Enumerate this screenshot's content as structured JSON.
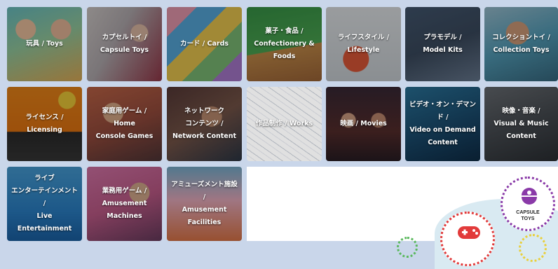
{
  "tiles": [
    {
      "key": "toys",
      "lines": [
        "玩具 / Toys"
      ]
    },
    {
      "key": "capsule",
      "lines": [
        "カプセルトイ /",
        "Capsule Toys"
      ]
    },
    {
      "key": "cards",
      "lines": [
        "カード / Cards"
      ]
    },
    {
      "key": "confection",
      "lines": [
        "菓子・食品 /",
        "Confectionery &",
        "Foods"
      ]
    },
    {
      "key": "lifestyle",
      "lines": [
        "ライフスタイル /",
        "Lifestyle"
      ]
    },
    {
      "key": "plamodel",
      "lines": [
        "プラモデル /",
        "Model Kits"
      ]
    },
    {
      "key": "collection",
      "lines": [
        "コレクショントイ /",
        "Collection Toys"
      ]
    },
    {
      "key": "licensing",
      "lines": [
        "ライセンス /",
        "Licensing"
      ]
    },
    {
      "key": "home_console",
      "lines": [
        "家庭用ゲーム /",
        "Home",
        "Console Games"
      ]
    },
    {
      "key": "network",
      "lines": [
        "ネットワーク",
        "コンテンツ /",
        "Network Content"
      ]
    },
    {
      "key": "works",
      "lines": [
        "作品制作 / Works"
      ]
    },
    {
      "key": "movies",
      "lines": [
        "映画 / Movies"
      ]
    },
    {
      "key": "vod",
      "lines": [
        "ビデオ・オン・デマンド /",
        "Video on Demand",
        "Content"
      ]
    },
    {
      "key": "visual_music",
      "lines": [
        "映像・音楽 /",
        "Visual & Music",
        "Content"
      ]
    },
    {
      "key": "live",
      "lines": [
        "ライブ",
        "エンターテインメント /",
        "Live",
        "Entertainment"
      ]
    },
    {
      "key": "amuse_machines",
      "lines": [
        "業務用ゲーム /",
        "Amusement",
        "Machines"
      ]
    },
    {
      "key": "amuse_facilities",
      "lines": [
        "アミューズメント施設 /",
        "Amusement",
        "Facilities"
      ]
    }
  ],
  "badges": {
    "capsule_toys": {
      "line1": "CAPSULE",
      "line2": "TOYS",
      "icon": "capsule-icon",
      "color": "#8a3aa8"
    },
    "games": {
      "icon": "gamepad-icon",
      "color": "#e23a3a"
    }
  }
}
